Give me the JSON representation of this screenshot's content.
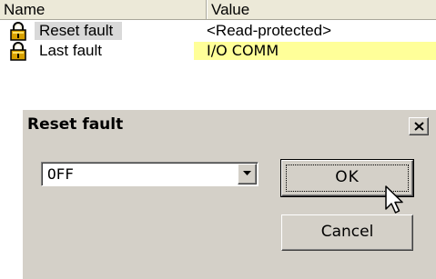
{
  "list": {
    "columns": {
      "name": "Name",
      "value": "Value"
    },
    "rows": [
      {
        "name": "Reset fault",
        "value": "<Read-protected>",
        "icon": "padlock-icon"
      },
      {
        "name": "Last fault",
        "value": "I/O COMM",
        "icon": "padlock-icon",
        "highlight": "#ffff99"
      }
    ]
  },
  "dialog": {
    "title": "Reset fault",
    "close_label": "×",
    "select": {
      "value": "OFF"
    },
    "ok_label": "OK",
    "cancel_label": "Cancel"
  },
  "colors": {
    "face": "#d4d0c8",
    "header": "#ece9d8",
    "value_highlight": "#ffff99",
    "selected_name": "#d9d9d9"
  }
}
